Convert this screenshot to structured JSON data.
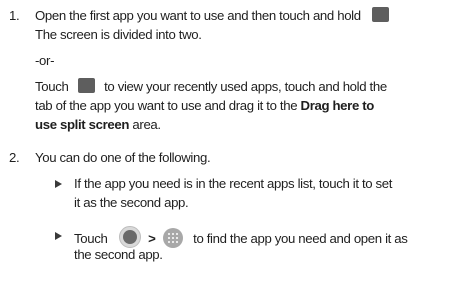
{
  "steps": [
    {
      "number": "1.",
      "line1": "Open the first app you want to use and then touch and hold",
      "line2": "The screen is divided into two.",
      "or_label": "-or-",
      "alt_l1_pre": "Touch",
      "alt_l1_post": "to view your recently used apps, touch and hold the",
      "alt_l2_pre": "tab of the app you want to use and drag it to the",
      "alt_l2_bold": "Drag here to",
      "alt_l3_bold": "use split screen",
      "alt_l3_post": "area."
    },
    {
      "number": "2.",
      "line1": "You can do one of the following.",
      "bullets": [
        {
          "line1": "If the app you need is in the recent apps list, touch it to set",
          "line2": "it as the second app."
        },
        {
          "pre": "Touch",
          "sep": ">",
          "post": "to find the app you need and open it as",
          "line2": "the second app."
        }
      ]
    }
  ],
  "icons": {
    "recent_apps": "recent-apps-square-icon",
    "home": "home-circle-icon",
    "apps": "apps-grid-icon"
  }
}
